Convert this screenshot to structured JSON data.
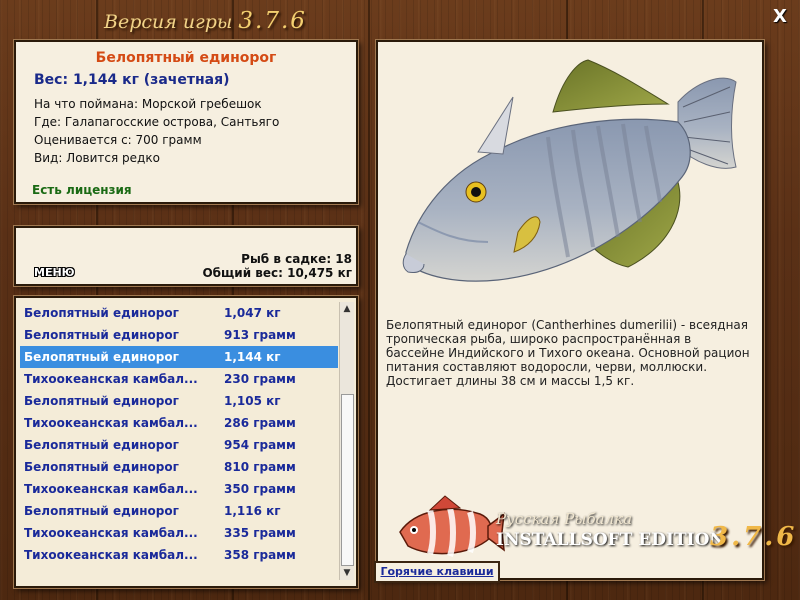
{
  "window": {
    "title_prefix": "Версия игры",
    "title_version": "3.7.6",
    "close_label": "X"
  },
  "fish_info": {
    "name": "Белопятный единорог",
    "weight_line": "Вес: 1,144 кг (зачетная)",
    "caught_with": "На что поймана: Морской гребешок",
    "location": "Где: Галапагосские острова, Сантьяго",
    "valued_from": "Оценивается с: 700 грамм",
    "kind": "Вид: Ловится редко",
    "license": "Есть лицензия"
  },
  "stats": {
    "menu_label": "МЕНЮ",
    "fish_in_keepnet": "Рыб в садке: 18",
    "total_weight": "Общий вес: 10,475 кг"
  },
  "catch_list": [
    {
      "name": "Белопятный единорог",
      "weight": "1,047 кг",
      "selected": false
    },
    {
      "name": "Белопятный единорог",
      "weight": "913 грамм",
      "selected": false
    },
    {
      "name": "Белопятный единорог",
      "weight": "1,144 кг",
      "selected": true
    },
    {
      "name": "Тихоокеанская камбал...",
      "weight": "230 грамм",
      "selected": false
    },
    {
      "name": "Белопятный единорог",
      "weight": "1,105 кг",
      "selected": false
    },
    {
      "name": "Тихоокеанская камбал...",
      "weight": "286 грамм",
      "selected": false
    },
    {
      "name": "Белопятный единорог",
      "weight": "954 грамм",
      "selected": false
    },
    {
      "name": "Белопятный единорог",
      "weight": "810 грамм",
      "selected": false
    },
    {
      "name": "Тихоокеанская камбал...",
      "weight": "350 грамм",
      "selected": false
    },
    {
      "name": "Белопятный единорог",
      "weight": "1,116 кг",
      "selected": false
    },
    {
      "name": "Тихоокеанская камбал...",
      "weight": "335 грамм",
      "selected": false
    },
    {
      "name": "Тихоокеанская камбал...",
      "weight": "358 грамм",
      "selected": false
    }
  ],
  "description": "Белопятный единорог (Cantherhines dumerilii) - всеядная тропическая рыба, широко распространённая в бассейне Индийского и Тихого океана. Основной рацион питания составляют водоросли, черви, моллюски. Достигает длины 38 см и массы 1,5 кг.",
  "logo": {
    "line1": "Русская Рыбалка",
    "line2": "INSTALLSOFT EDITION",
    "version": "3.7.6"
  },
  "hotkeys_label": "Горячие клавиши",
  "colors": {
    "selection": "#3a8ee0",
    "fish_name": "#d44a14",
    "list_text": "#1a2a9a",
    "license": "#1a6a14"
  }
}
